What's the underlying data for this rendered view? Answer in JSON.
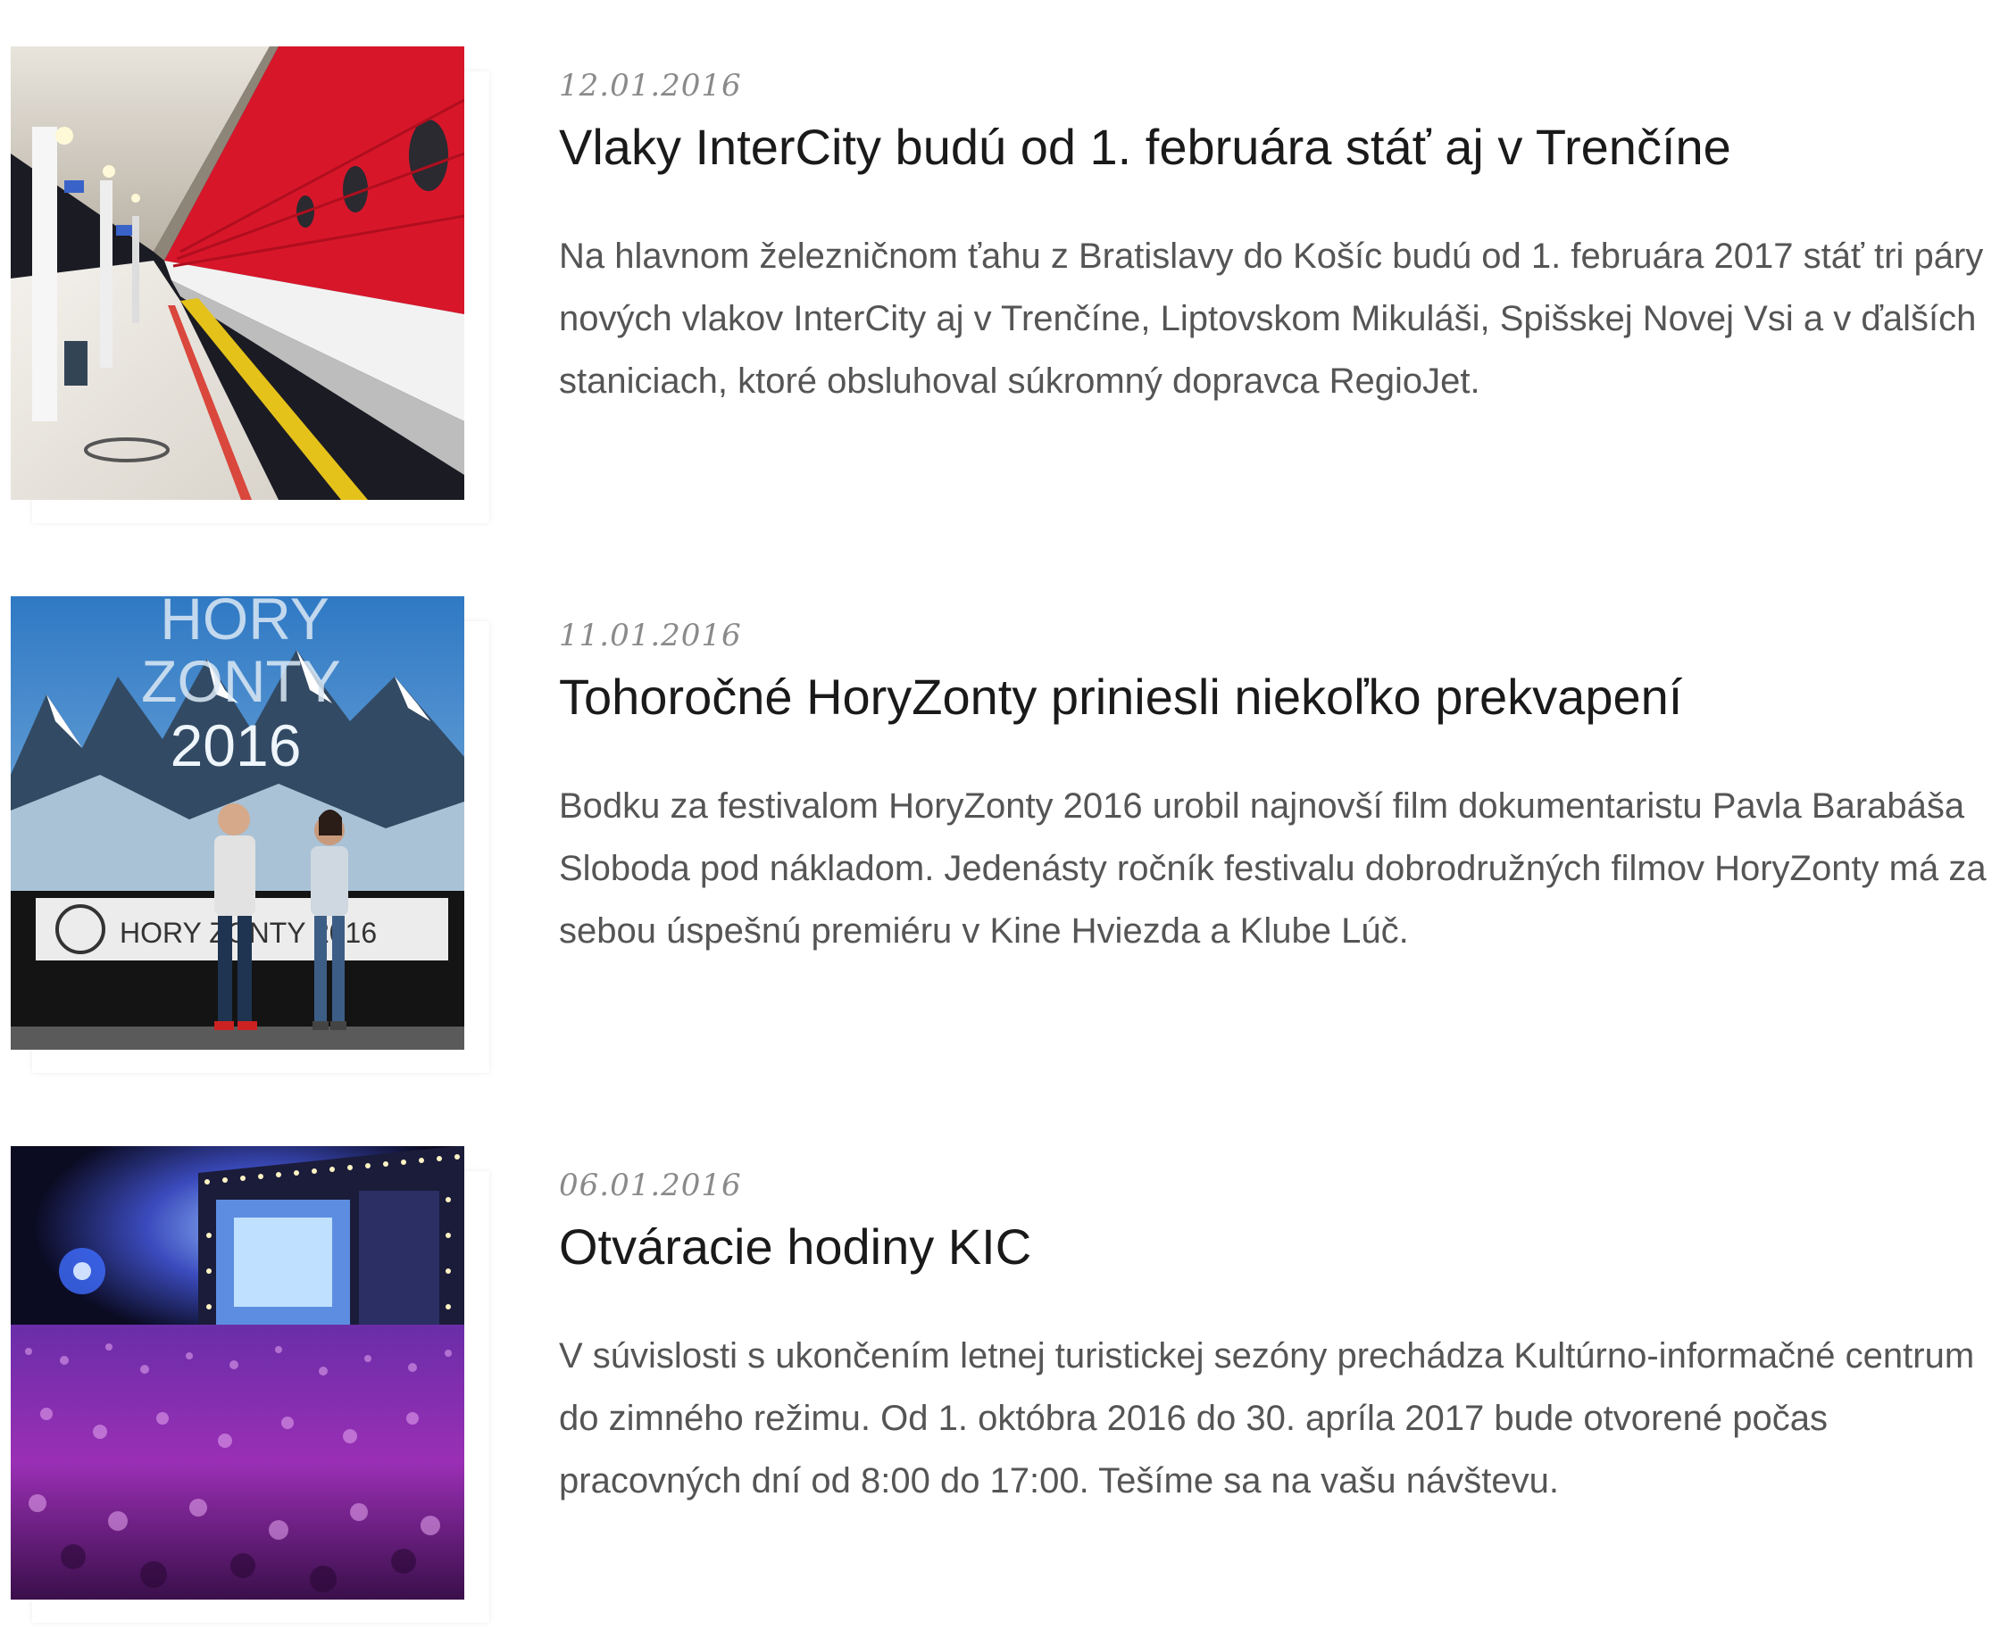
{
  "news": [
    {
      "date": "12.01.2016",
      "title": "Vlaky InterCity budú od 1. februára stáť aj v Trenčíne",
      "excerpt": "Na hlavnom železničnom ťahu z Bratislavy do Košíc budú od 1. februára 2017 stáť tri páry nových vlakov InterCity aj v Trenčíne, Liptovskom Mikuláši, Spišskej Novej Vsi a v ďalších staniciach, ktoré obsluhoval súkromný dopravca RegioJet."
    },
    {
      "date": "11.01.2016",
      "title": "Tohoročné HoryZonty priniesli niekoľko prekvapení",
      "excerpt": "Bodku za festivalom HoryZonty 2016 urobil najnovší film dokumentaristu Pavla Barabáša Sloboda pod nákladom. Jedenásty ročník festivalu dobrodružných filmov HoryZonty má za sebou úspešnú premiéru v Kine Hviezda a Klube Lúč.",
      "image_text": {
        "banner_line1": "HORY",
        "banner_line2": "ZONTY",
        "banner_line3": "2016",
        "stage_banner": "HORY ZONTY 2016"
      }
    },
    {
      "date": "06.01.2016",
      "title": "Otváracie hodiny KIC",
      "excerpt": "V súvislosti s ukončením letnej turistickej sezóny prechádza Kultúrno-informačné centrum do zimného režimu. Od 1. októbra 2016 do 30. apríla 2017 bude otvorené počas pracovných dní od 8:00 do 17:00. Tešíme sa na vašu návštevu."
    }
  ],
  "colors": {
    "title": "#1a1a1a",
    "excerpt": "#555555",
    "date": "#8a8a8a",
    "train_red": "#d8162a"
  }
}
